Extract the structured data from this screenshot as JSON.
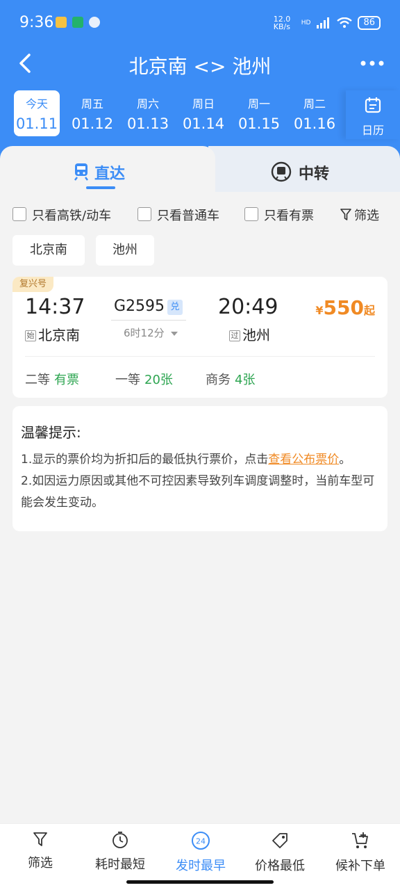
{
  "status": {
    "time": "9:36",
    "net": "12.0 KB/s",
    "hd": "HD",
    "battery": "86"
  },
  "header": {
    "title": "北京南 <> 池州"
  },
  "dates": [
    {
      "week": "今天",
      "date": "01.11"
    },
    {
      "week": "周五",
      "date": "01.12"
    },
    {
      "week": "周六",
      "date": "01.13"
    },
    {
      "week": "周日",
      "date": "01.14"
    },
    {
      "week": "周一",
      "date": "01.15"
    },
    {
      "week": "周二",
      "date": "01.16"
    }
  ],
  "calendar_label": "日历",
  "tabs": {
    "direct": "直达",
    "transfer": "中转"
  },
  "filters": {
    "high_speed": "只看高铁/动车",
    "normal": "只看普通车",
    "available": "只看有票",
    "screen": "筛选"
  },
  "station_chips": [
    "北京南",
    "池州"
  ],
  "train": {
    "badge": "复兴号",
    "depart_time": "14:37",
    "arrive_time": "20:49",
    "depart_tag": "始",
    "depart_station": "北京南",
    "arrive_tag": "过",
    "arrive_station": "池州",
    "number": "G2595",
    "exchange": "兑",
    "duration": "6时12分",
    "price_symbol": "¥",
    "price": "550",
    "price_suffix": "起",
    "seats": [
      {
        "label": "二等",
        "value": "有票"
      },
      {
        "label": "一等",
        "value": "20张"
      },
      {
        "label": "商务",
        "value": "4张"
      }
    ]
  },
  "tips": {
    "heading": "温馨提示:",
    "line1_pre": "1.显示的票价均为折扣后的最低执行票价，点击",
    "line1_link": "查看公布票价",
    "line1_post": "。",
    "line2": "2.如因运力原因或其他不可控因素导致列车调度调整时，当前车型可能会发生变动。"
  },
  "bottom": [
    {
      "label": "筛选",
      "icon": "filter-icon"
    },
    {
      "label": "耗时最短",
      "icon": "timer-icon"
    },
    {
      "label": "发时最早",
      "icon": "clock-24-icon"
    },
    {
      "label": "价格最低",
      "icon": "price-tag-icon"
    },
    {
      "label": "候补下单",
      "icon": "cart-plus-icon"
    }
  ],
  "colors": {
    "primary": "#3c8df6",
    "accent": "#f08a24",
    "green": "#2da551"
  }
}
